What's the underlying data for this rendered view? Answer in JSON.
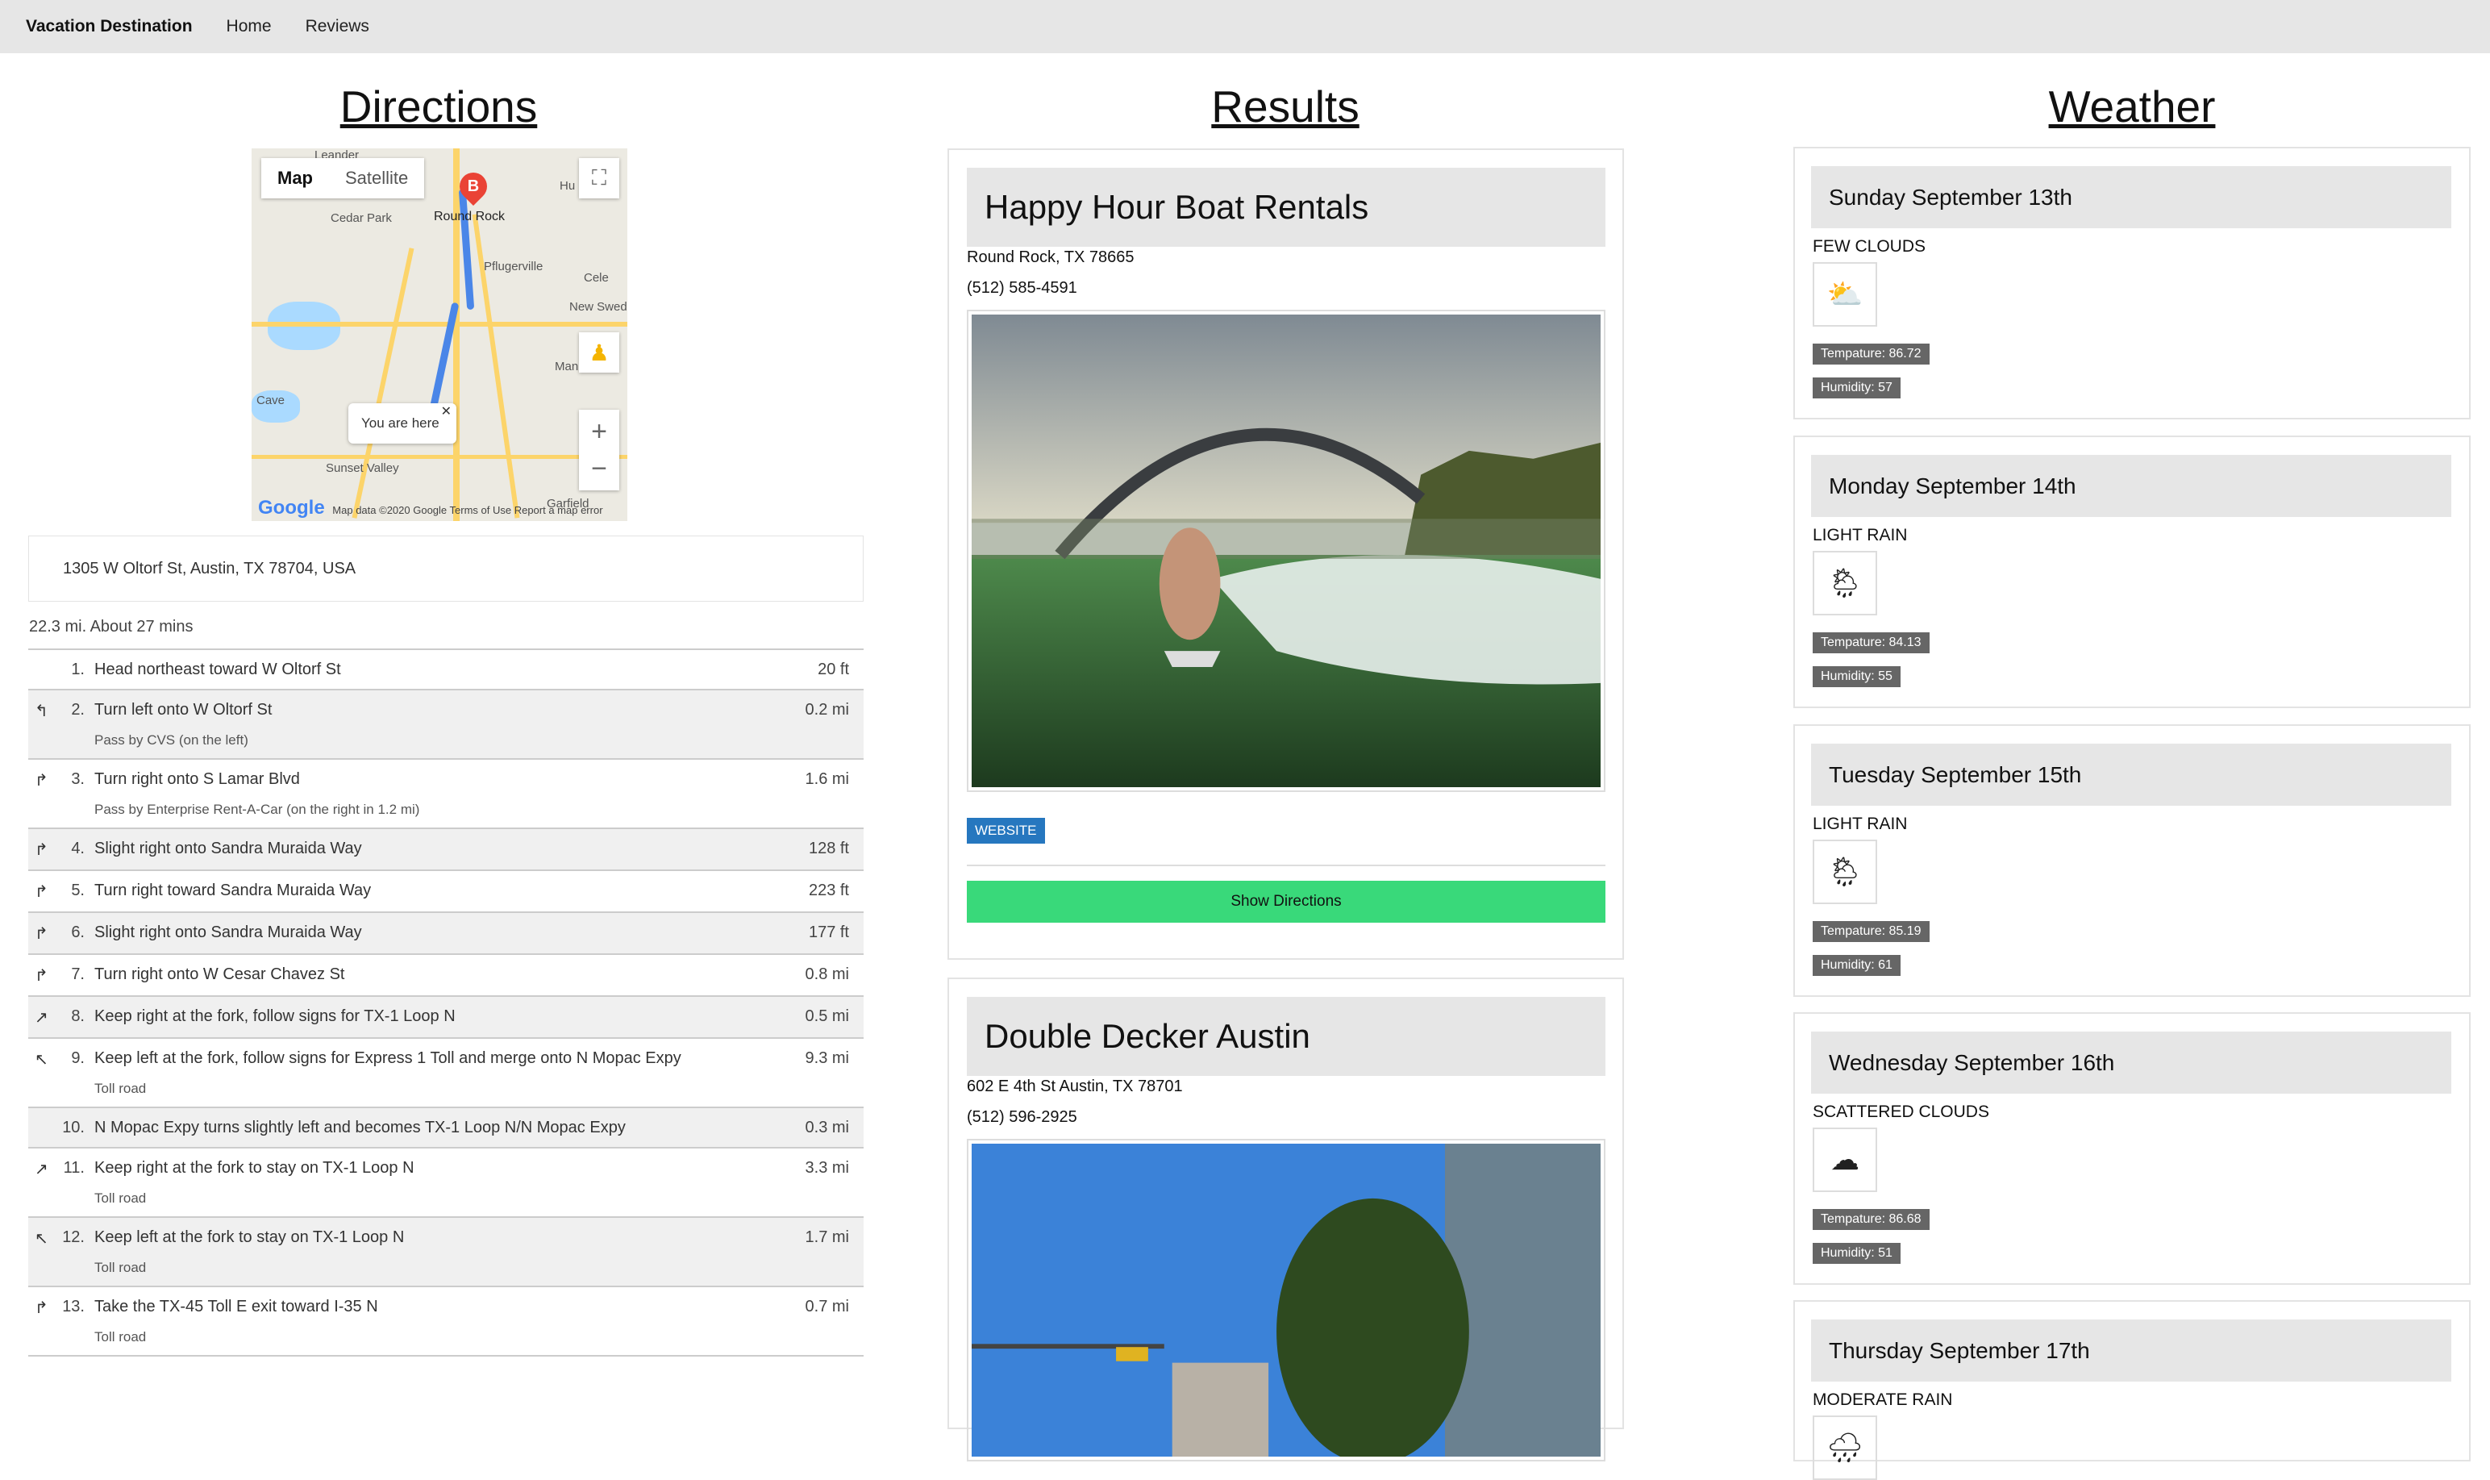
{
  "nav": {
    "brand": "Vacation Destination",
    "home": "Home",
    "reviews": "Reviews"
  },
  "titles": {
    "directions": "Directions",
    "results": "Results",
    "weather": "Weather"
  },
  "map": {
    "map_button": "Map",
    "satellite_button": "Satellite",
    "marker_label": "B",
    "popup_text": "You are here",
    "google_logo": "Google",
    "footer": "Map data ©2020 Google   Terms of Use   Report a map error",
    "labels": [
      "Leander",
      "Cedar Park",
      "Round Rock",
      "Pflugerville",
      "Cele",
      "New Swed",
      "Man",
      "Cave",
      "Sunset Valley",
      "Garfield",
      "Hu"
    ]
  },
  "directions": {
    "address": "1305 W Oltorf St, Austin, TX 78704, USA",
    "summary": "22.3 mi. About 27 mins",
    "steps": [
      {
        "icon": "",
        "num": "1.",
        "text": "Head northeast toward W Oltorf St",
        "sub": "",
        "dist": "20 ft"
      },
      {
        "icon": "↰",
        "num": "2.",
        "text": "Turn left onto W Oltorf St",
        "sub": "Pass by CVS (on the left)",
        "dist": "0.2 mi"
      },
      {
        "icon": "↱",
        "num": "3.",
        "text": "Turn right onto S Lamar Blvd",
        "sub": "Pass by Enterprise Rent-A-Car (on the right in 1.2 mi)",
        "dist": "1.6 mi"
      },
      {
        "icon": "↱",
        "num": "4.",
        "text": "Slight right onto Sandra Muraida Way",
        "sub": "",
        "dist": "128 ft"
      },
      {
        "icon": "↱",
        "num": "5.",
        "text": "Turn right toward Sandra Muraida Way",
        "sub": "",
        "dist": "223 ft"
      },
      {
        "icon": "↱",
        "num": "6.",
        "text": "Slight right onto Sandra Muraida Way",
        "sub": "",
        "dist": "177 ft"
      },
      {
        "icon": "↱",
        "num": "7.",
        "text": "Turn right onto W Cesar Chavez St",
        "sub": "",
        "dist": "0.8 mi"
      },
      {
        "icon": "↗",
        "num": "8.",
        "text": "Keep right at the fork, follow signs for TX-1 Loop N",
        "sub": "",
        "dist": "0.5 mi"
      },
      {
        "icon": "↖",
        "num": "9.",
        "text": "Keep left at the fork, follow signs for Express 1 Toll and merge onto N Mopac Expy",
        "sub": "Toll road",
        "dist": "9.3 mi"
      },
      {
        "icon": "",
        "num": "10.",
        "text": "N Mopac Expy turns slightly left and becomes TX-1 Loop N/N Mopac Expy",
        "sub": "",
        "dist": "0.3 mi"
      },
      {
        "icon": "↗",
        "num": "11.",
        "text": "Keep right at the fork to stay on TX-1 Loop N",
        "sub": "Toll road",
        "dist": "3.3 mi"
      },
      {
        "icon": "↖",
        "num": "12.",
        "text": "Keep left at the fork to stay on TX-1 Loop N",
        "sub": "Toll road",
        "dist": "1.7 mi"
      },
      {
        "icon": "↱",
        "num": "13.",
        "text": "Take the TX-45 Toll E exit toward I-35 N",
        "sub": "Toll road",
        "dist": "0.7 mi"
      }
    ]
  },
  "results": [
    {
      "name": "Happy Hour Boat Rentals",
      "address": "Round Rock, TX 78665",
      "phone": "(512) 585-4591",
      "website": "WEBSITE",
      "show_directions": "Show Directions"
    },
    {
      "name": "Double Decker Austin",
      "address": "602 E 4th St Austin, TX 78701",
      "phone": "(512) 596-2925"
    }
  ],
  "weather": [
    {
      "day": "Sunday September 13th",
      "desc": "FEW CLOUDS",
      "icon": "few-clouds-icon",
      "temp": "Tempature: 86.72",
      "humidity": "Humidity: 57"
    },
    {
      "day": "Monday September 14th",
      "desc": "LIGHT RAIN",
      "icon": "light-rain-icon",
      "temp": "Tempature: 84.13",
      "humidity": "Humidity: 55"
    },
    {
      "day": "Tuesday September 15th",
      "desc": "LIGHT RAIN",
      "icon": "light-rain-icon",
      "temp": "Tempature: 85.19",
      "humidity": "Humidity: 61"
    },
    {
      "day": "Wednesday September 16th",
      "desc": "SCATTERED CLOUDS",
      "icon": "scattered-clouds-icon",
      "temp": "Tempature: 86.68",
      "humidity": "Humidity: 51"
    },
    {
      "day": "Thursday September 17th",
      "desc": "MODERATE RAIN",
      "icon": "moderate-rain-icon"
    }
  ]
}
